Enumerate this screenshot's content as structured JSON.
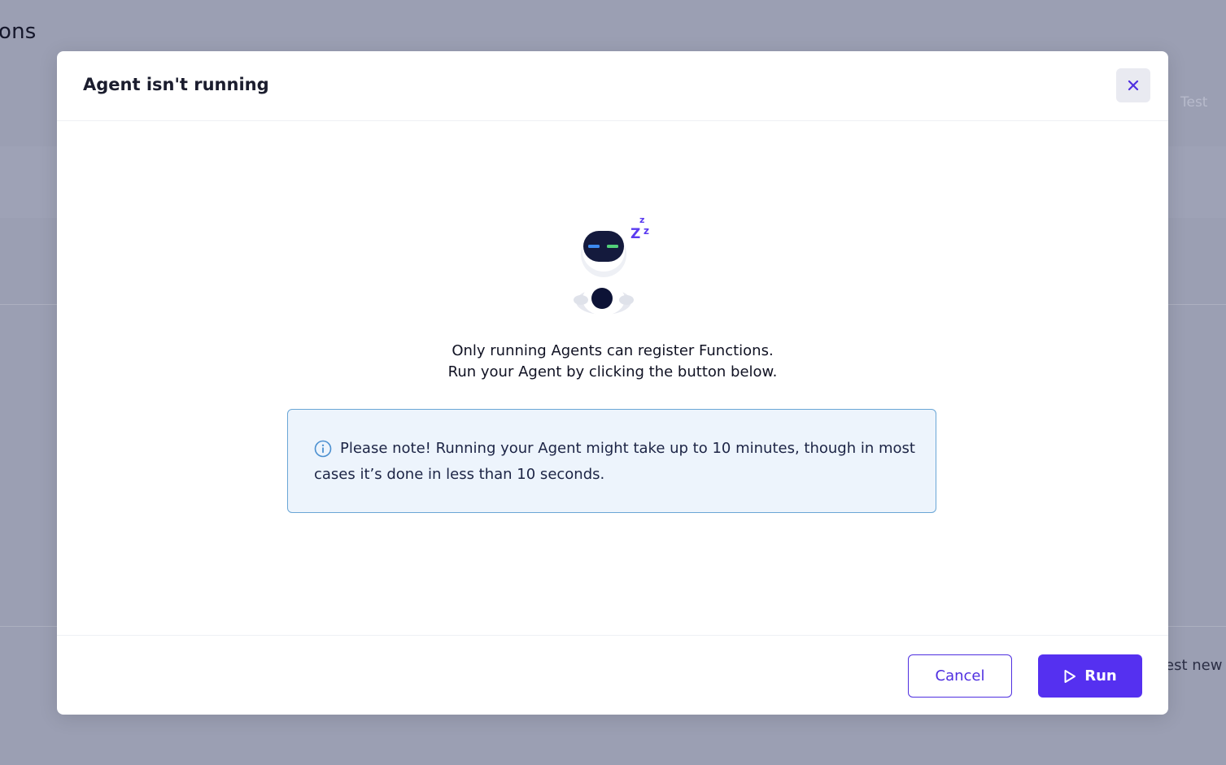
{
  "background": {
    "page_title_fragment": "ons",
    "test_tab_label": "Test",
    "bottom_text_fragment": "est new f"
  },
  "modal": {
    "title": "Agent isn't running",
    "close_icon": "close-icon",
    "illustration": "sleeping-robot",
    "message_line1": "Only running Agents can register Functions.",
    "message_line2": "Run your Agent by clicking the button below.",
    "note": {
      "icon": "info-icon",
      "text": "Please note! Running your Agent might take up to 10 minutes, though in most cases it’s done in less than 10 seconds."
    },
    "footer": {
      "cancel_label": "Cancel",
      "run_label": "Run",
      "run_icon": "play-icon"
    }
  },
  "colors": {
    "accent": "#5530f0",
    "overlay": "#9b9fb3",
    "note_background": "#edf4fc",
    "note_border": "#6aa6d6"
  }
}
